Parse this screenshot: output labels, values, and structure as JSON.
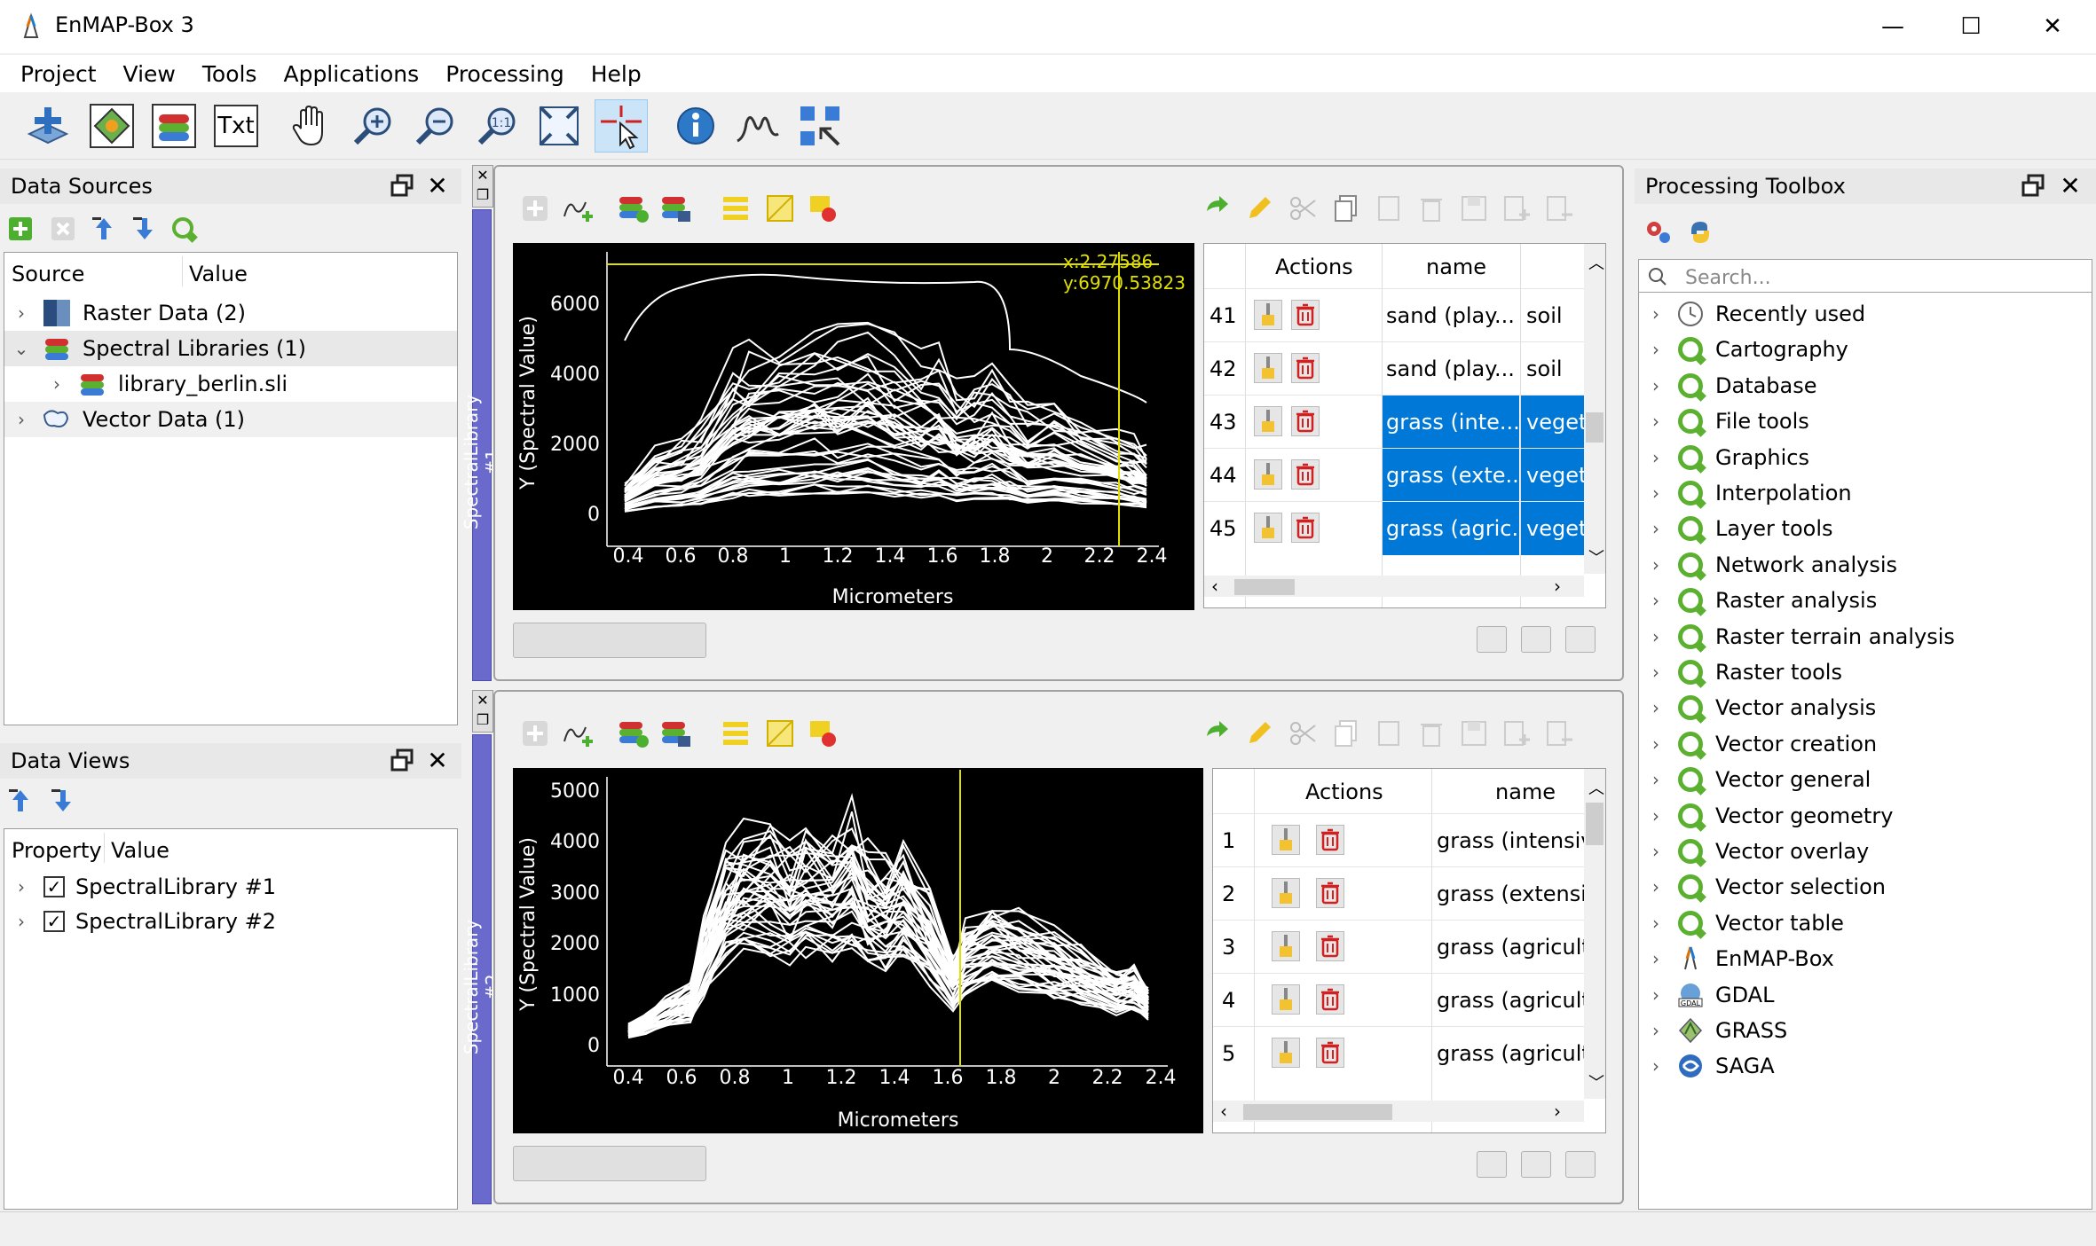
{
  "window": {
    "title": "EnMAP-Box 3",
    "minimize": "—",
    "maximize": "☐",
    "close": "✕"
  },
  "menu": [
    "Project",
    "View",
    "Tools",
    "Applications",
    "Processing",
    "Help"
  ],
  "toolbar": {
    "txt_label": "Txt",
    "zoom_1to1": "1:1"
  },
  "data_sources": {
    "title": "Data Sources",
    "col_source": "Source",
    "col_value": "Value",
    "items": [
      {
        "label": "Raster Data (2)"
      },
      {
        "label": "Spectral Libraries (1)"
      },
      {
        "label": "library_berlin.sli"
      },
      {
        "label": "Vector Data (1)"
      }
    ]
  },
  "data_views": {
    "title": "Data Views",
    "col_property": "Property",
    "col_value": "Value",
    "items": [
      {
        "label": "SpectralLibrary #1"
      },
      {
        "label": "SpectralLibrary #2"
      }
    ]
  },
  "speclib1": {
    "tab": "SpectralLibrary #1",
    "xlabel": "Micrometers",
    "ylabel": "Y (Spectral Value)",
    "yticks": [
      "0",
      "2000",
      "4000",
      "6000"
    ],
    "xticks": [
      "0.4",
      "0.6",
      "0.8",
      "1",
      "1.2",
      "1.4",
      "1.6",
      "1.8",
      "2",
      "2.2",
      "2.4"
    ],
    "cursor_x": "x:2.27586",
    "cursor_y": "y:6970.53823",
    "table": {
      "col_actions": "Actions",
      "col_name": "name",
      "rows": [
        {
          "id": "41",
          "name": "sand (play...",
          "class": "soil"
        },
        {
          "id": "42",
          "name": "sand (play...",
          "class": "soil"
        },
        {
          "id": "43",
          "name": "grass (inte...",
          "class": "veget"
        },
        {
          "id": "44",
          "name": "grass (exte...",
          "class": "veget"
        },
        {
          "id": "45",
          "name": "grass (agric...",
          "class": "veget"
        }
      ]
    }
  },
  "speclib2": {
    "tab": "SpectralLibrary #2",
    "xlabel": "Micrometers",
    "ylabel": "Y (Spectral Value)",
    "yticks": [
      "0",
      "1000",
      "2000",
      "3000",
      "4000",
      "5000"
    ],
    "xticks": [
      "0.4",
      "0.6",
      "0.8",
      "1",
      "1.2",
      "1.4",
      "1.6",
      "1.8",
      "2",
      "2.2",
      "2.4"
    ],
    "table": {
      "col_actions": "Actions",
      "col_name": "name",
      "rows": [
        {
          "id": "1",
          "name": "grass (intensiv"
        },
        {
          "id": "2",
          "name": "grass (extensiv"
        },
        {
          "id": "3",
          "name": "grass (agriculti"
        },
        {
          "id": "4",
          "name": "grass (agriculti"
        },
        {
          "id": "5",
          "name": "grass (agriculti"
        }
      ]
    }
  },
  "processing": {
    "title": "Processing Toolbox",
    "search_placeholder": "Search...",
    "items": [
      {
        "label": "Recently used",
        "icon": "clock-icon"
      },
      {
        "label": "Cartography",
        "icon": "qgis-icon"
      },
      {
        "label": "Database",
        "icon": "qgis-icon"
      },
      {
        "label": "File tools",
        "icon": "qgis-icon"
      },
      {
        "label": "Graphics",
        "icon": "qgis-icon"
      },
      {
        "label": "Interpolation",
        "icon": "qgis-icon"
      },
      {
        "label": "Layer tools",
        "icon": "qgis-icon"
      },
      {
        "label": "Network analysis",
        "icon": "qgis-icon"
      },
      {
        "label": "Raster analysis",
        "icon": "qgis-icon"
      },
      {
        "label": "Raster terrain analysis",
        "icon": "qgis-icon"
      },
      {
        "label": "Raster tools",
        "icon": "qgis-icon"
      },
      {
        "label": "Vector analysis",
        "icon": "qgis-icon"
      },
      {
        "label": "Vector creation",
        "icon": "qgis-icon"
      },
      {
        "label": "Vector general",
        "icon": "qgis-icon"
      },
      {
        "label": "Vector geometry",
        "icon": "qgis-icon"
      },
      {
        "label": "Vector overlay",
        "icon": "qgis-icon"
      },
      {
        "label": "Vector selection",
        "icon": "qgis-icon"
      },
      {
        "label": "Vector table",
        "icon": "qgis-icon"
      },
      {
        "label": "EnMAP-Box",
        "icon": "enmap-icon"
      },
      {
        "label": "GDAL",
        "icon": "gdal-icon"
      },
      {
        "label": "GRASS",
        "icon": "grass-icon"
      },
      {
        "label": "SAGA",
        "icon": "saga-icon"
      }
    ]
  },
  "colors": {
    "selection": "#0078d7",
    "dock_tab": "#6a6acc",
    "cursor_line": "#e0e000",
    "qgis_green": "#5bb030"
  }
}
